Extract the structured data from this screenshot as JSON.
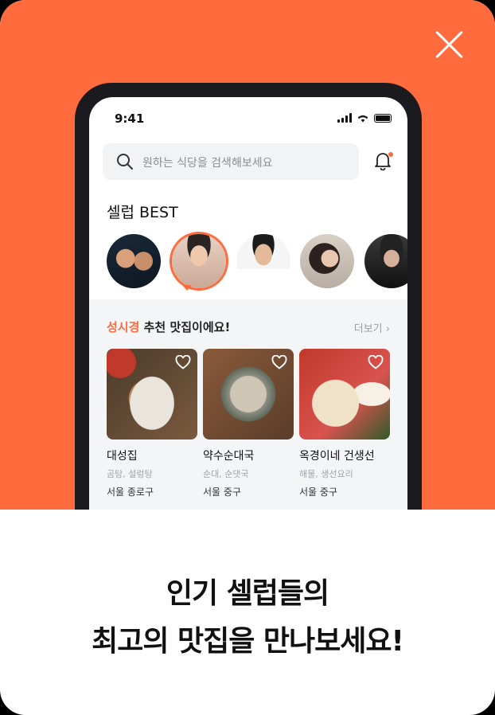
{
  "close_icon": "close-icon",
  "status": {
    "time": "9:41"
  },
  "search": {
    "placeholder": "원하는 식당을 검색해보세요"
  },
  "section": {
    "title": "셀럽 BEST"
  },
  "recommend": {
    "name": "성시경",
    "suffix": " 추천 맛집이에요!",
    "more": "더보기"
  },
  "restaurants": [
    {
      "name": "대성집",
      "category": "곰탕, 설렁탕",
      "location": "서울 종로구"
    },
    {
      "name": "약수순대국",
      "category": "순대, 순댓국",
      "location": "서울 중구"
    },
    {
      "name": "옥경이네 건생선",
      "category": "해물, 생선요리",
      "location": "서울 중구"
    }
  ],
  "caption": {
    "line1": "인기 셀럽들의",
    "line2": "최고의 맛집을 만나보세요!"
  },
  "colors": {
    "accent": "#FF6B3D"
  }
}
